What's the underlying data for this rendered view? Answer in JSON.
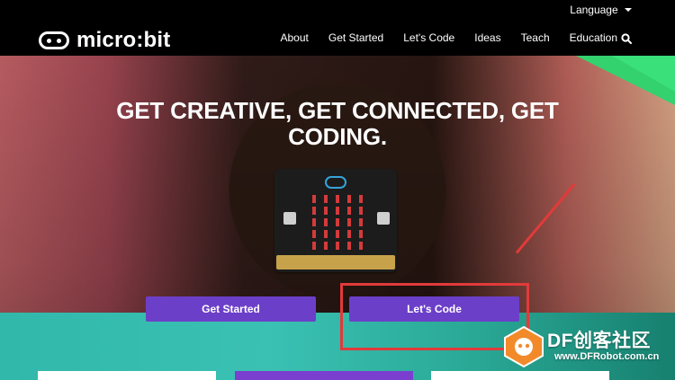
{
  "header": {
    "language_label": "Language",
    "brand": "micro:bit",
    "nav": [
      "About",
      "Get Started",
      "Let's Code",
      "Ideas",
      "Teach",
      "Education"
    ]
  },
  "hero": {
    "headline_line1": "GET CREATIVE, GET CONNECTED, GET",
    "headline_line2": "CODING.",
    "buttons": {
      "get_started": "Get Started",
      "lets_code": "Let's Code"
    }
  },
  "watermark": {
    "title": "DF创客社区",
    "url": "www.DFRobot.com.cn"
  },
  "colors": {
    "button_purple": "#6c3fc9",
    "highlight_red": "#e23a3a",
    "teal": "#31b8aa",
    "green": "#34d16f"
  },
  "icons": [
    "search-icon",
    "caret-down-icon",
    "micro-bit-logo-icon",
    "dfrobot-logo-icon"
  ]
}
